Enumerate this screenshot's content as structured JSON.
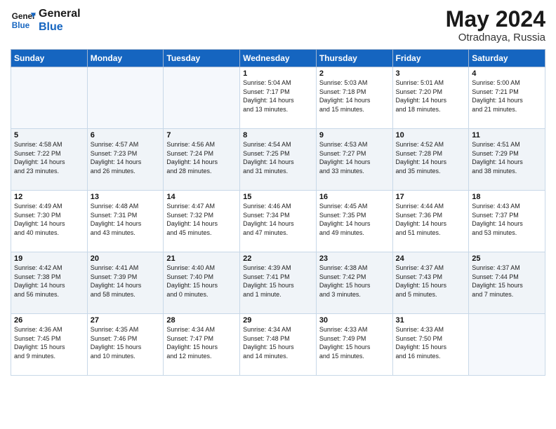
{
  "logo": {
    "line1": "General",
    "line2": "Blue"
  },
  "title": "May 2024",
  "location": "Otradnaya, Russia",
  "weekdays": [
    "Sunday",
    "Monday",
    "Tuesday",
    "Wednesday",
    "Thursday",
    "Friday",
    "Saturday"
  ],
  "weeks": [
    [
      {
        "day": "",
        "info": ""
      },
      {
        "day": "",
        "info": ""
      },
      {
        "day": "",
        "info": ""
      },
      {
        "day": "1",
        "info": "Sunrise: 5:04 AM\nSunset: 7:17 PM\nDaylight: 14 hours\nand 13 minutes."
      },
      {
        "day": "2",
        "info": "Sunrise: 5:03 AM\nSunset: 7:18 PM\nDaylight: 14 hours\nand 15 minutes."
      },
      {
        "day": "3",
        "info": "Sunrise: 5:01 AM\nSunset: 7:20 PM\nDaylight: 14 hours\nand 18 minutes."
      },
      {
        "day": "4",
        "info": "Sunrise: 5:00 AM\nSunset: 7:21 PM\nDaylight: 14 hours\nand 21 minutes."
      }
    ],
    [
      {
        "day": "5",
        "info": "Sunrise: 4:58 AM\nSunset: 7:22 PM\nDaylight: 14 hours\nand 23 minutes."
      },
      {
        "day": "6",
        "info": "Sunrise: 4:57 AM\nSunset: 7:23 PM\nDaylight: 14 hours\nand 26 minutes."
      },
      {
        "day": "7",
        "info": "Sunrise: 4:56 AM\nSunset: 7:24 PM\nDaylight: 14 hours\nand 28 minutes."
      },
      {
        "day": "8",
        "info": "Sunrise: 4:54 AM\nSunset: 7:25 PM\nDaylight: 14 hours\nand 31 minutes."
      },
      {
        "day": "9",
        "info": "Sunrise: 4:53 AM\nSunset: 7:27 PM\nDaylight: 14 hours\nand 33 minutes."
      },
      {
        "day": "10",
        "info": "Sunrise: 4:52 AM\nSunset: 7:28 PM\nDaylight: 14 hours\nand 35 minutes."
      },
      {
        "day": "11",
        "info": "Sunrise: 4:51 AM\nSunset: 7:29 PM\nDaylight: 14 hours\nand 38 minutes."
      }
    ],
    [
      {
        "day": "12",
        "info": "Sunrise: 4:49 AM\nSunset: 7:30 PM\nDaylight: 14 hours\nand 40 minutes."
      },
      {
        "day": "13",
        "info": "Sunrise: 4:48 AM\nSunset: 7:31 PM\nDaylight: 14 hours\nand 43 minutes."
      },
      {
        "day": "14",
        "info": "Sunrise: 4:47 AM\nSunset: 7:32 PM\nDaylight: 14 hours\nand 45 minutes."
      },
      {
        "day": "15",
        "info": "Sunrise: 4:46 AM\nSunset: 7:34 PM\nDaylight: 14 hours\nand 47 minutes."
      },
      {
        "day": "16",
        "info": "Sunrise: 4:45 AM\nSunset: 7:35 PM\nDaylight: 14 hours\nand 49 minutes."
      },
      {
        "day": "17",
        "info": "Sunrise: 4:44 AM\nSunset: 7:36 PM\nDaylight: 14 hours\nand 51 minutes."
      },
      {
        "day": "18",
        "info": "Sunrise: 4:43 AM\nSunset: 7:37 PM\nDaylight: 14 hours\nand 53 minutes."
      }
    ],
    [
      {
        "day": "19",
        "info": "Sunrise: 4:42 AM\nSunset: 7:38 PM\nDaylight: 14 hours\nand 56 minutes."
      },
      {
        "day": "20",
        "info": "Sunrise: 4:41 AM\nSunset: 7:39 PM\nDaylight: 14 hours\nand 58 minutes."
      },
      {
        "day": "21",
        "info": "Sunrise: 4:40 AM\nSunset: 7:40 PM\nDaylight: 15 hours\nand 0 minutes."
      },
      {
        "day": "22",
        "info": "Sunrise: 4:39 AM\nSunset: 7:41 PM\nDaylight: 15 hours\nand 1 minute."
      },
      {
        "day": "23",
        "info": "Sunrise: 4:38 AM\nSunset: 7:42 PM\nDaylight: 15 hours\nand 3 minutes."
      },
      {
        "day": "24",
        "info": "Sunrise: 4:37 AM\nSunset: 7:43 PM\nDaylight: 15 hours\nand 5 minutes."
      },
      {
        "day": "25",
        "info": "Sunrise: 4:37 AM\nSunset: 7:44 PM\nDaylight: 15 hours\nand 7 minutes."
      }
    ],
    [
      {
        "day": "26",
        "info": "Sunrise: 4:36 AM\nSunset: 7:45 PM\nDaylight: 15 hours\nand 9 minutes."
      },
      {
        "day": "27",
        "info": "Sunrise: 4:35 AM\nSunset: 7:46 PM\nDaylight: 15 hours\nand 10 minutes."
      },
      {
        "day": "28",
        "info": "Sunrise: 4:34 AM\nSunset: 7:47 PM\nDaylight: 15 hours\nand 12 minutes."
      },
      {
        "day": "29",
        "info": "Sunrise: 4:34 AM\nSunset: 7:48 PM\nDaylight: 15 hours\nand 14 minutes."
      },
      {
        "day": "30",
        "info": "Sunrise: 4:33 AM\nSunset: 7:49 PM\nDaylight: 15 hours\nand 15 minutes."
      },
      {
        "day": "31",
        "info": "Sunrise: 4:33 AM\nSunset: 7:50 PM\nDaylight: 15 hours\nand 16 minutes."
      },
      {
        "day": "",
        "info": ""
      }
    ]
  ]
}
